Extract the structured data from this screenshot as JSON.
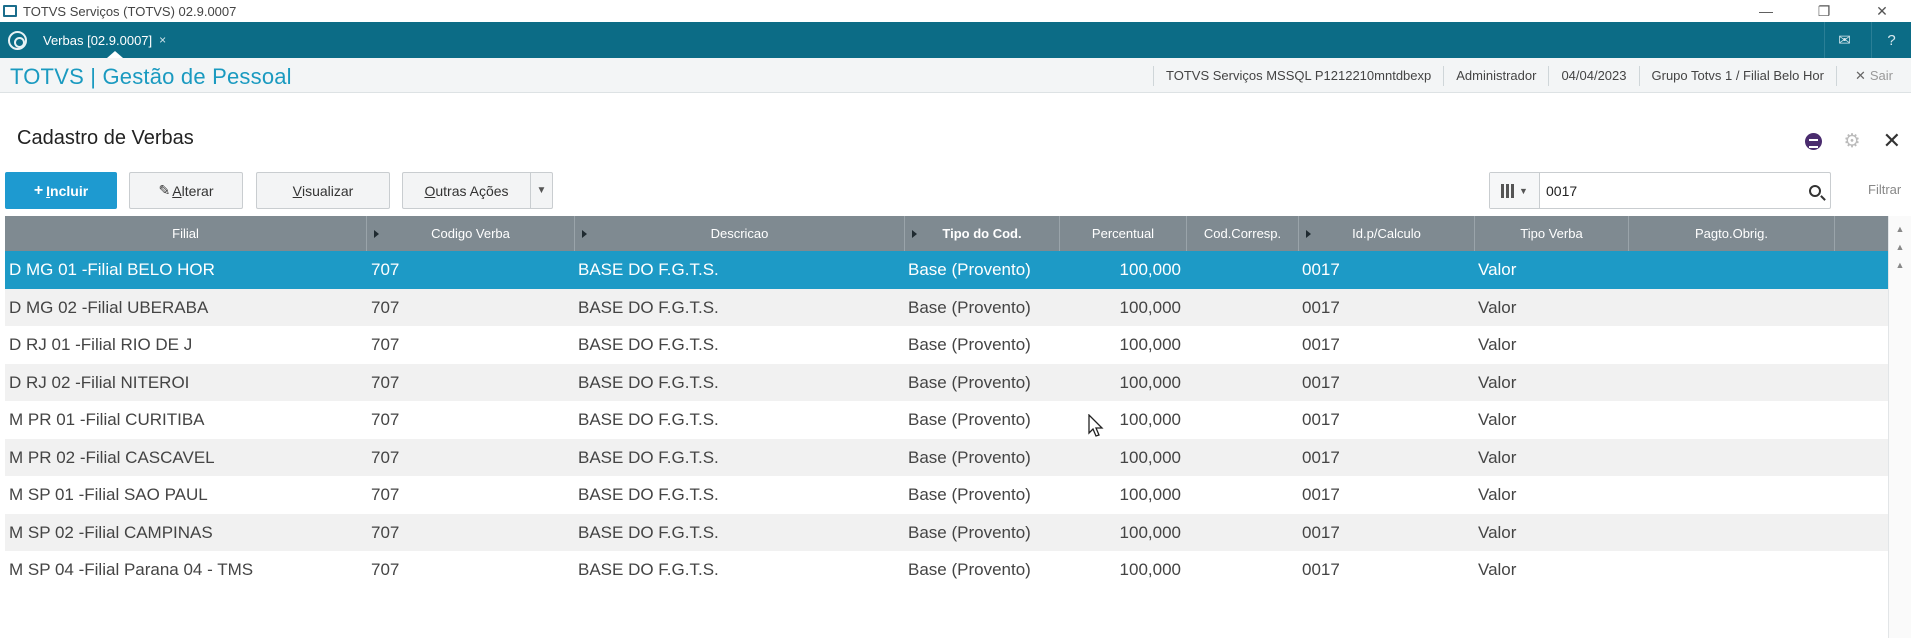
{
  "window": {
    "title": "TOTVS Serviços (TOTVS) 02.9.0007",
    "controls": {
      "minimize": "—",
      "restore": "❐",
      "close": "✕"
    }
  },
  "tabbar": {
    "active_tab": "Verbas [02.9.0007]",
    "tab_close": "×",
    "mail_icon": "✉",
    "help_icon": "?"
  },
  "header": {
    "brand": "TOTVS | Gestão de Pessoal",
    "environment": "TOTVS Serviços MSSQL P1212210mntdbexp",
    "user": "Administrador",
    "date": "04/04/2023",
    "company": "Grupo Totvs 1 / Filial Belo Hor",
    "sair_icon": "✕",
    "sair": "Sair"
  },
  "page": {
    "title": "Cadastro de Verbas",
    "close_icon": "✕",
    "gear_icon": "⚙"
  },
  "toolbar": {
    "incluir_icon": "+",
    "incluir_first": "I",
    "incluir_rest": "ncluir",
    "alterar_icon": "✎",
    "alterar_first": "A",
    "alterar_rest": "lterar",
    "visualizar_first": "V",
    "visualizar_rest": "isualizar",
    "outras_first": "O",
    "outras_rest": "utras Ações",
    "outras_caret": "▼"
  },
  "search": {
    "value": "0017",
    "columns_arrow": "▼",
    "filter_label": "Filtrar"
  },
  "grid": {
    "columns": [
      "Filial",
      "Codigo Verba",
      "Descricao",
      "Tipo do Cod.",
      "Percentual",
      "Cod.Corresp.",
      "Id.p/Calculo",
      "Tipo Verba",
      "Pagto.Obrig."
    ],
    "rows": [
      {
        "filial": "D MG 01 -Filial BELO HOR",
        "codigo": "707",
        "descricao": "BASE DO F.G.T.S.",
        "tipo": "Base (Provento)",
        "percentual": "100,000",
        "corresp": "",
        "idcalc": "0017",
        "tipoverba": "Valor",
        "pagto": ""
      },
      {
        "filial": "D MG 02 -Filial UBERABA",
        "codigo": "707",
        "descricao": "BASE DO F.G.T.S.",
        "tipo": "Base (Provento)",
        "percentual": "100,000",
        "corresp": "",
        "idcalc": "0017",
        "tipoverba": "Valor",
        "pagto": ""
      },
      {
        "filial": "D RJ 01 -Filial RIO DE J",
        "codigo": "707",
        "descricao": "BASE DO F.G.T.S.",
        "tipo": "Base (Provento)",
        "percentual": "100,000",
        "corresp": "",
        "idcalc": "0017",
        "tipoverba": "Valor",
        "pagto": ""
      },
      {
        "filial": "D RJ 02 -Filial NITEROI",
        "codigo": "707",
        "descricao": "BASE DO F.G.T.S.",
        "tipo": "Base (Provento)",
        "percentual": "100,000",
        "corresp": "",
        "idcalc": "0017",
        "tipoverba": "Valor",
        "pagto": ""
      },
      {
        "filial": "M PR 01 -Filial CURITIBA",
        "codigo": "707",
        "descricao": "BASE DO F.G.T.S.",
        "tipo": "Base (Provento)",
        "percentual": "100,000",
        "corresp": "",
        "idcalc": "0017",
        "tipoverba": "Valor",
        "pagto": ""
      },
      {
        "filial": "M PR 02 -Filial CASCAVEL",
        "codigo": "707",
        "descricao": "BASE DO F.G.T.S.",
        "tipo": "Base (Provento)",
        "percentual": "100,000",
        "corresp": "",
        "idcalc": "0017",
        "tipoverba": "Valor",
        "pagto": ""
      },
      {
        "filial": "M SP 01 -Filial SAO PAUL",
        "codigo": "707",
        "descricao": "BASE DO F.G.T.S.",
        "tipo": "Base (Provento)",
        "percentual": "100,000",
        "corresp": "",
        "idcalc": "0017",
        "tipoverba": "Valor",
        "pagto": ""
      },
      {
        "filial": "M SP 02 -Filial CAMPINAS",
        "codigo": "707",
        "descricao": "BASE DO F.G.T.S.",
        "tipo": "Base (Provento)",
        "percentual": "100,000",
        "corresp": "",
        "idcalc": "0017",
        "tipoverba": "Valor",
        "pagto": ""
      },
      {
        "filial": "M SP 04 -Filial Parana 04 - TMS",
        "codigo": "707",
        "descricao": "BASE DO F.G.T.S.",
        "tipo": "Base (Provento)",
        "percentual": "100,000",
        "corresp": "",
        "idcalc": "0017",
        "tipoverba": "Valor",
        "pagto": ""
      }
    ],
    "selected_row": 0
  },
  "scroll": {
    "top_icon": "▲",
    "up_icon": "▲",
    "step_icon": "▲"
  },
  "colors": {
    "teal": "#0c6c86",
    "brand": "#1a9ac0",
    "primary": "#1e9ad0",
    "selected_row": "#1d9ac6",
    "grid_header": "#7f8a91"
  }
}
